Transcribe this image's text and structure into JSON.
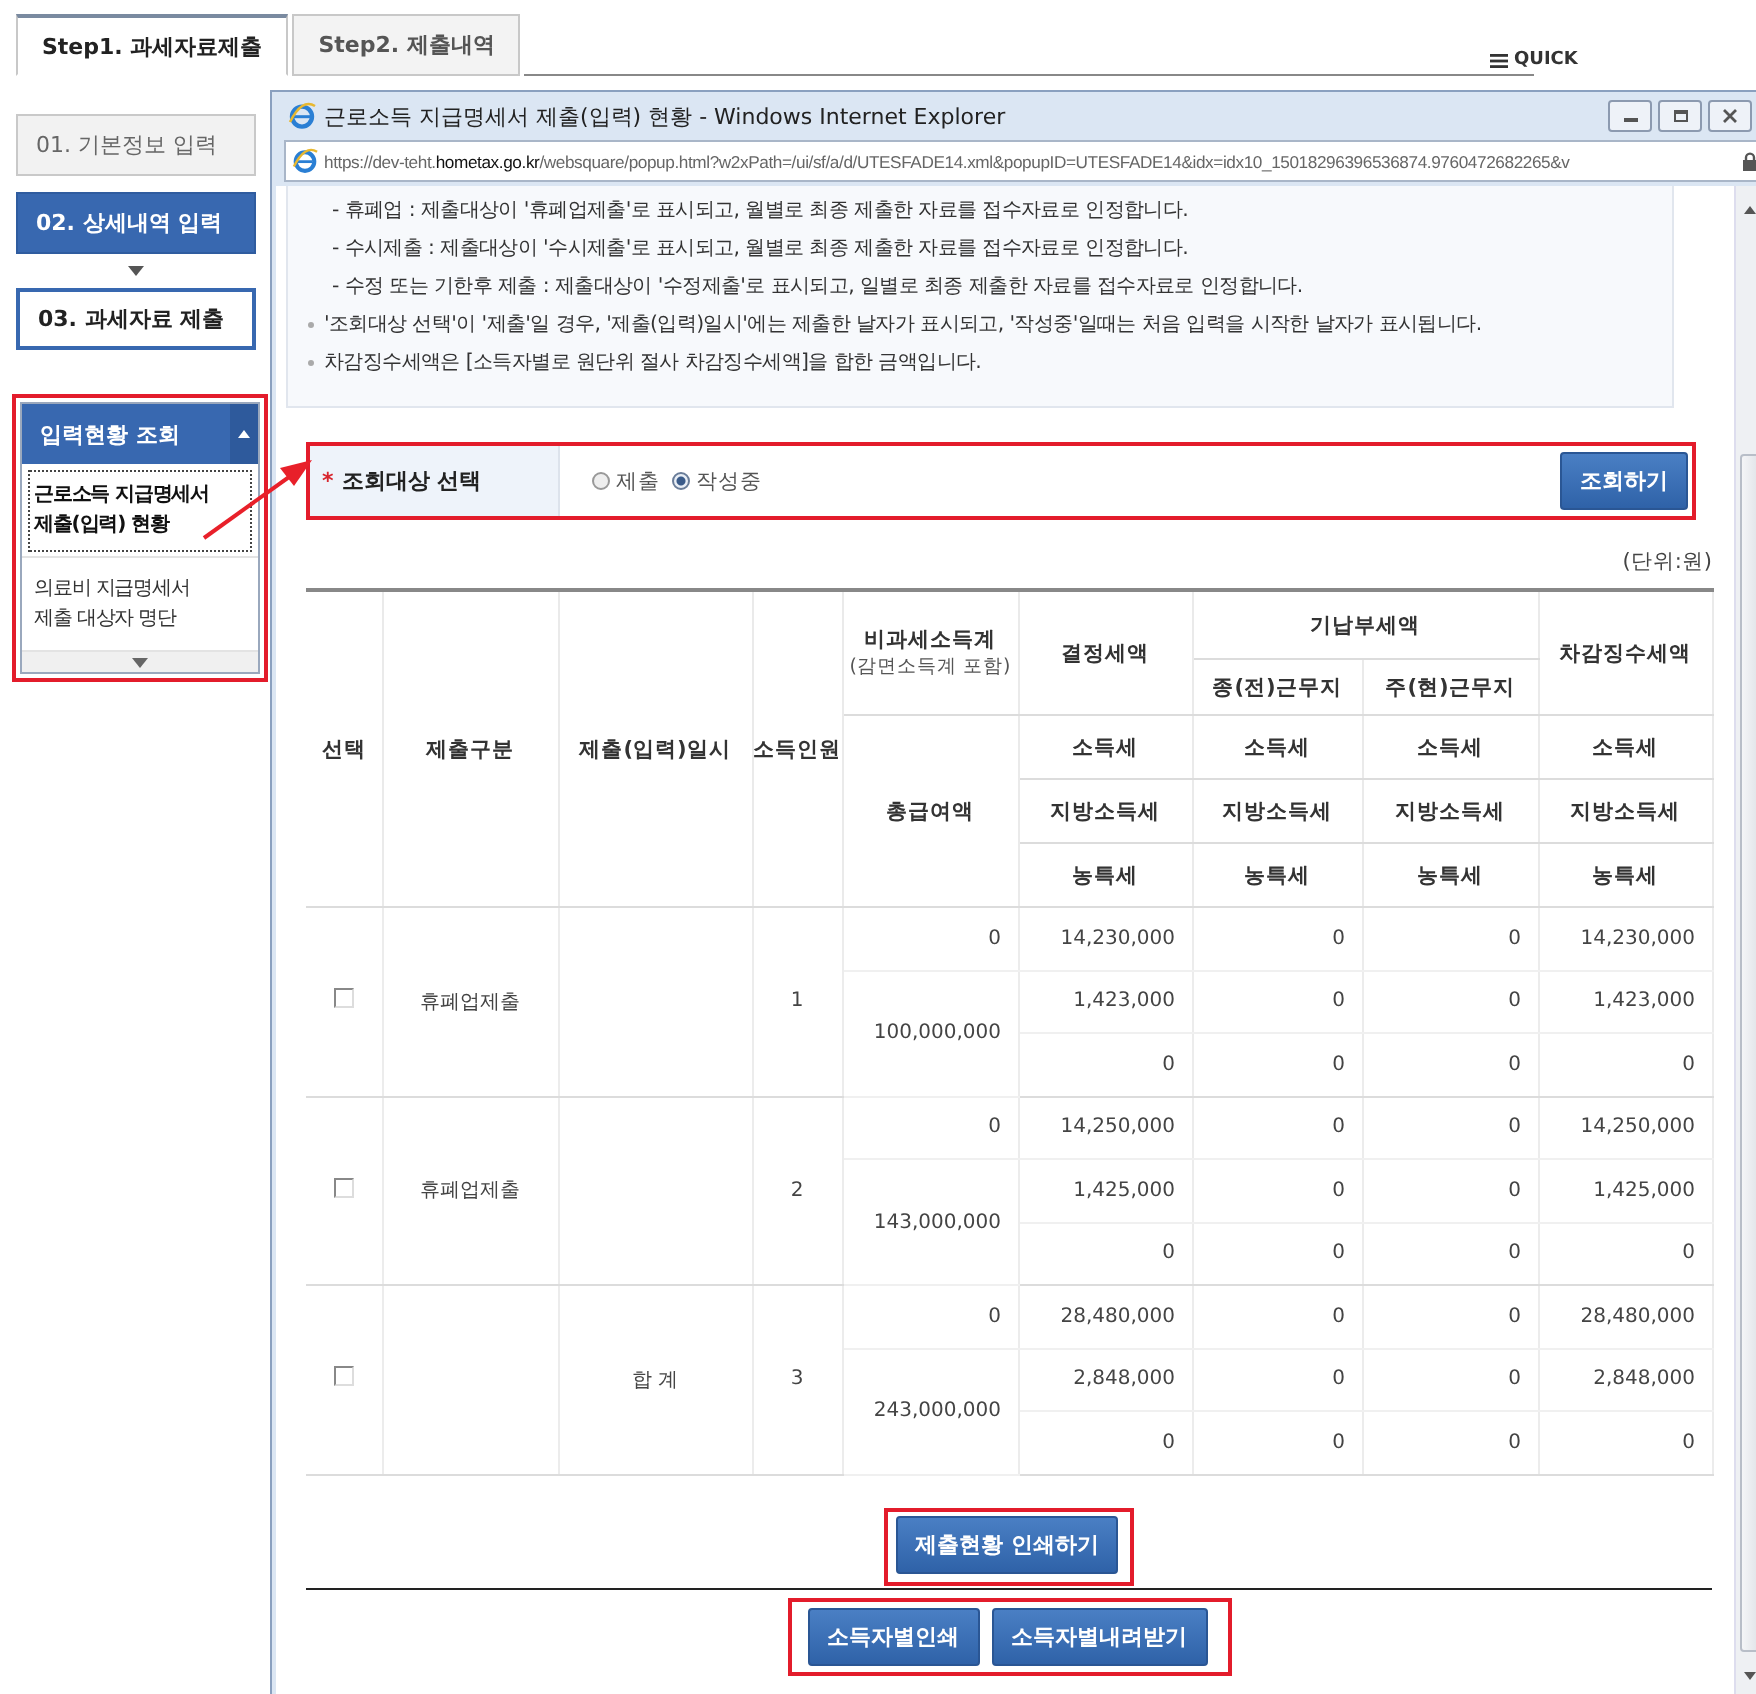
{
  "page_tabs": [
    {
      "label": "Step1. 과세자료제출",
      "selected": true
    },
    {
      "label": "Step2. 제출내역",
      "selected": false
    }
  ],
  "quick": "QUICK",
  "steps": [
    {
      "label": "01. 기본정보 입력",
      "selected": false,
      "completed": true
    },
    {
      "label": "02. 상세내역 입력",
      "selected": true,
      "completed": false
    },
    {
      "label": "03. 과세자료 제출",
      "selected": false,
      "completed": false
    }
  ],
  "lookup_panel": {
    "title": "입력현황 조회",
    "expanded": true,
    "items": [
      {
        "label": "근로소득 지급명세서\n제출(입력) 현황",
        "selected": true
      },
      {
        "label": "의료비 지급명세서\n제출 대상자 명단",
        "selected": false
      }
    ]
  },
  "popup": {
    "title": "근로소득 지급명세서 제출(입력) 현황 - Windows Internet Explorer",
    "url": "https://dev-teht.**hometax.go.kr**/websquare/popup.html?w2xPath=/ui/sf/a/d/UTESFADE14.xml&popupID=UTESFADE14&idx=idx10_15018296396536874.9760472682265&v",
    "notes": [
      {
        "kind": "dash",
        "text": "- 휴폐업 :  제출대상이 '휴폐업제출'로 표시되고, 월별로 최종 제출한 자료를 접수자료로 인정합니다."
      },
      {
        "kind": "dash",
        "text": "- 수시제출 :  제출대상이 '수시제출'로 표시되고, 월별로 최종 제출한 자료를 접수자료로 인정합니다."
      },
      {
        "kind": "dash",
        "text": "- 수정 또는 기한후 제출 : 제출대상이 '수정제출'로 표시되고, 일별로 최종 제출한 자료를 접수자료로 인정합니다."
      },
      {
        "kind": "bullet",
        "text": "'조회대상 선택'이 '제출'일 경우, '제출(입력)일시'에는 제출한 날자가 표시되고, '작성중'일때는 처음 입력을 시작한 날자가 표시됩니다."
      },
      {
        "kind": "bullet",
        "text": "차감징수세액은 [소득자별로 원단위 절사 차감징수세액]을 합한 금액입니다."
      }
    ],
    "filter": {
      "label": "조회대상 선택",
      "required_mark": "*",
      "options": [
        {
          "label": "제출",
          "selected": false
        },
        {
          "label": "작성중",
          "selected": true
        }
      ],
      "button": "조회하기"
    },
    "unit": "(단위:원)",
    "table": {
      "head": {
        "select": "선택",
        "type": "제출구분",
        "submitted_at": "제출(입력)일시",
        "count": "소득인원",
        "nontaxable": "비과세소득계",
        "nontaxable_note": "(감면소득계 포함)",
        "total_pay": "총급여액",
        "determined": "결정세액",
        "prepaid": "기납부세액",
        "prev_work": "종(전)근무지",
        "curr_work": "주(현)근무지",
        "deduction": "차감징수세액",
        "tax_rows": [
          [
            "소득세",
            "소득세",
            "소득세",
            "소득세"
          ],
          [
            "지방소득세",
            "지방소득세",
            "지방소득세",
            "지방소득세"
          ],
          [
            "농특세",
            "농특세",
            "농특세",
            "농특세"
          ]
        ]
      },
      "rows": [
        {
          "checked": false,
          "type": "휴폐업제출",
          "count": "1",
          "nontaxable": "0",
          "total_pay": "100,000,000",
          "values": [
            [
              "14,230,000",
              "0",
              "0",
              "14,230,000"
            ],
            [
              "1,423,000",
              "0",
              "0",
              "1,423,000"
            ],
            [
              "0",
              "0",
              "0",
              "0"
            ]
          ]
        },
        {
          "checked": false,
          "type": "휴폐업제출",
          "count": "2",
          "nontaxable": "0",
          "total_pay": "143,000,000",
          "values": [
            [
              "14,250,000",
              "0",
              "0",
              "14,250,000"
            ],
            [
              "1,425,000",
              "0",
              "0",
              "1,425,000"
            ],
            [
              "0",
              "0",
              "0",
              "0"
            ]
          ]
        },
        {
          "checked": false,
          "submitted_at": "합 계",
          "count": "3",
          "nontaxable": "0",
          "total_pay": "243,000,000",
          "values": [
            [
              "28,480,000",
              "0",
              "0",
              "28,480,000"
            ],
            [
              "2,848,000",
              "0",
              "0",
              "2,848,000"
            ],
            [
              "0",
              "0",
              "0",
              "0"
            ]
          ]
        }
      ]
    },
    "print_button": "제출현황 인쇄하기",
    "bottom_buttons": [
      "소득자별인쇄",
      "소득자별내려받기"
    ]
  }
}
